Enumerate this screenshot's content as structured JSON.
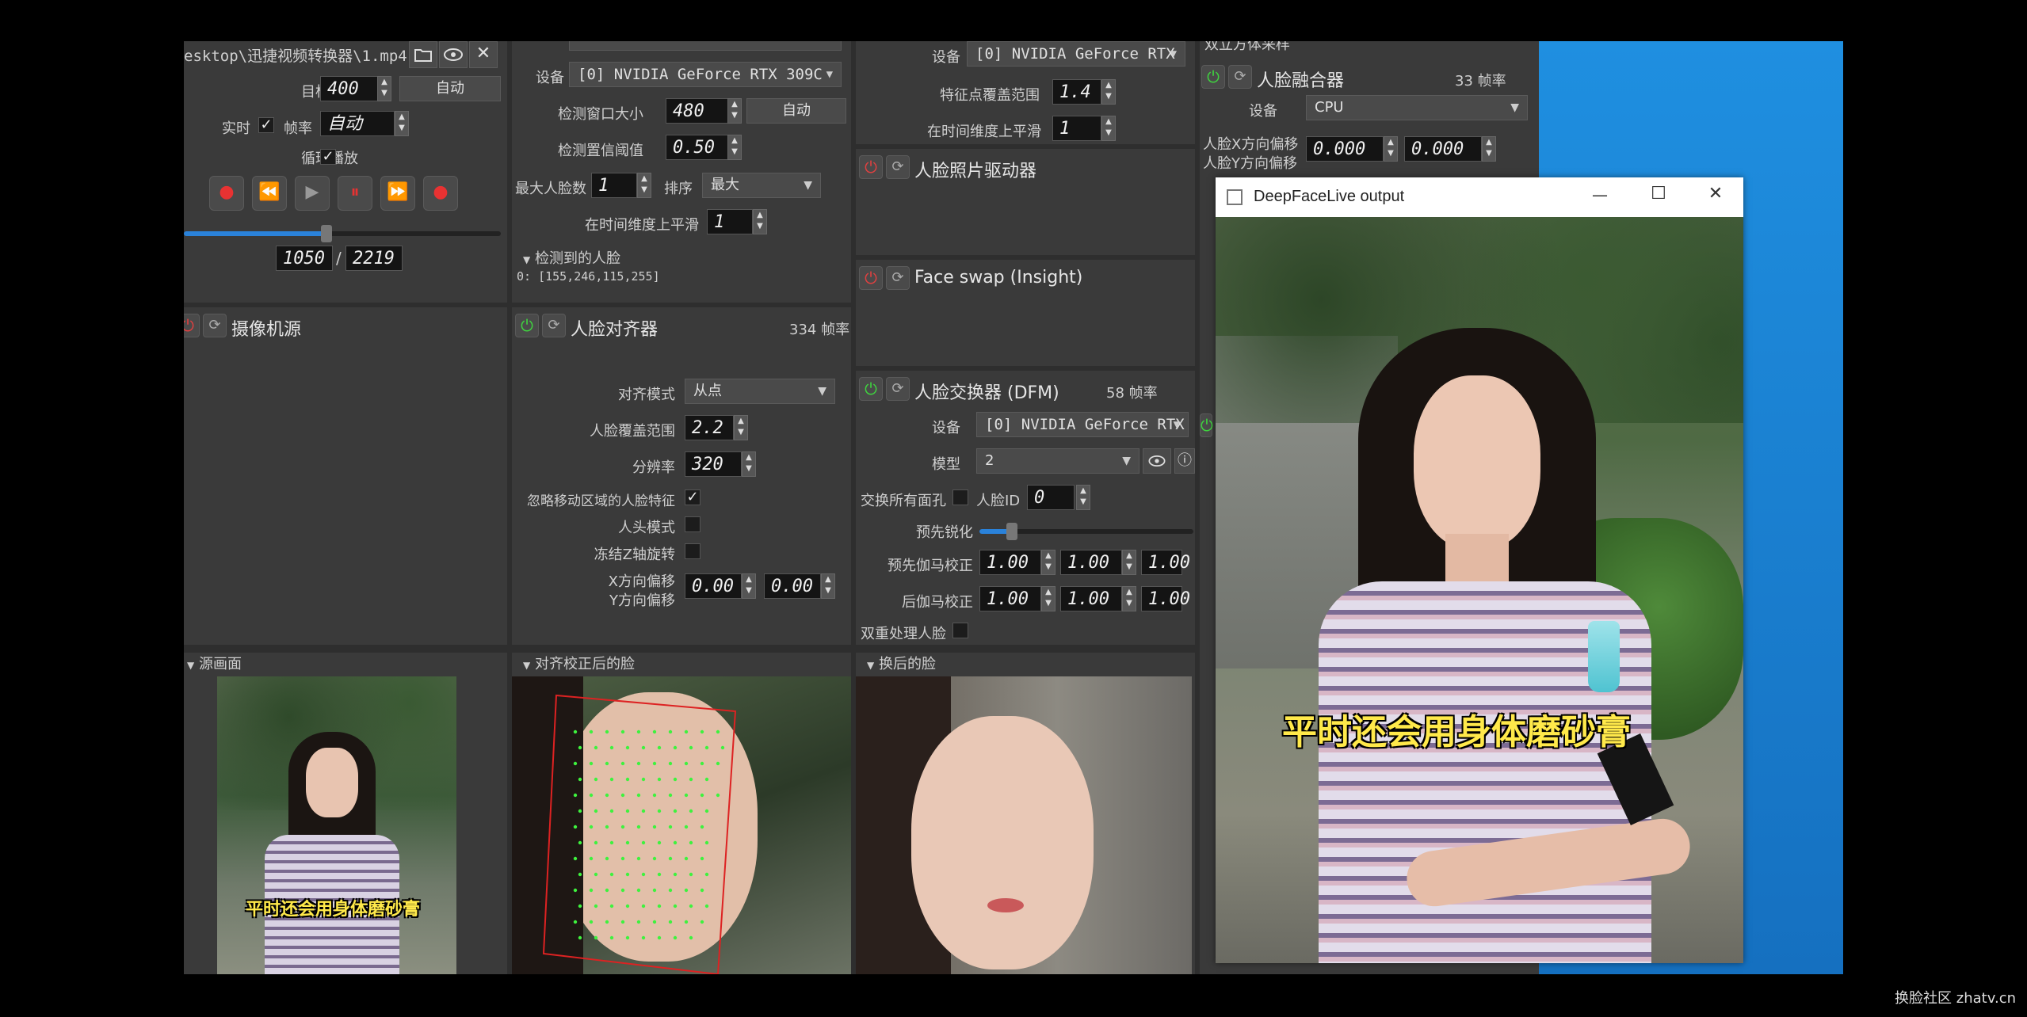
{
  "watermark": "换脸社区 zhatv.cn",
  "source_panel": {
    "path": "esktop\\迅捷视频转换器\\1.mp4",
    "target_width_label": "目标宽度",
    "target_width_value": "400",
    "auto_button": "自动",
    "realtime_label": "实时",
    "fps_label": "帧率",
    "fps_value": "自动",
    "loop_label": "循环播放",
    "frame_current": "1050",
    "frame_separator": "/",
    "frame_total": "2219",
    "progress": 0.45
  },
  "camera_source": {
    "title": "摄像机源"
  },
  "detector": {
    "device_label": "设备",
    "device_value": "[0] NVIDIA GeForce RTX 309C",
    "window_size_label": "检测窗口大小",
    "window_size_value": "480",
    "auto_button": "自动",
    "threshold_label": "检测置信阈值",
    "threshold_value": "0.50",
    "max_faces_label": "最大人脸数",
    "max_faces_value": "1",
    "sort_label": "排序",
    "sort_value": "最大",
    "smooth_label": "在时间维度上平滑",
    "smooth_value": "1",
    "detected_label": "检测到的人脸",
    "detected_value": "0: [155,246,115,255]"
  },
  "aligner": {
    "title": "人脸对齐器",
    "fps": "334 帧率",
    "align_mode_label": "对齐模式",
    "align_mode_value": "从点",
    "coverage_label": "人脸覆盖范围",
    "coverage_value": "2.2",
    "resolution_label": "分辨率",
    "resolution_value": "320",
    "exclude_moving_label": "忽略移动区域的人脸特征",
    "head_mode_label": "人头模式",
    "freeze_z_label": "冻结Z轴旋转",
    "x_offset_label": "X方向偏移",
    "y_offset_label": "Y方向偏移",
    "x_offset_value": "0.00",
    "y_offset_value": "0.00"
  },
  "marker": {
    "device_label": "设备",
    "device_value": "[0] NVIDIA GeForce RTX 3",
    "coverage_label": "特征点覆盖范围",
    "coverage_value": "1.4",
    "smooth_label": "在时间维度上平滑",
    "smooth_value": "1"
  },
  "animator": {
    "title": "人脸照片驱动器"
  },
  "insight": {
    "title": "Face swap (Insight)"
  },
  "dfm": {
    "title": "人脸交换器 (DFM)",
    "fps": "58 帧率",
    "device_label": "设备",
    "device_value": "[0] NVIDIA GeForce RTX",
    "model_label": "模型",
    "model_value": "2",
    "swap_all_label": "交换所有面孔",
    "face_id_label": "人脸ID",
    "face_id_value": "0",
    "presharpen_label": "预先锐化",
    "presharpen_level": 0.15,
    "pre_gamma_label": "预先伽马校正",
    "post_gamma_label": "后伽马校正",
    "gamma_values": [
      "1.00",
      "1.00",
      "1.00"
    ],
    "post_gamma_values": [
      "1.00",
      "1.00",
      "1.00"
    ],
    "two_pass_label": "双重处理人脸"
  },
  "merger": {
    "header_cut": "双立方体采样",
    "title": "人脸融合器",
    "fps": "33 帧率",
    "device_label": "设备",
    "device_value": "CPU",
    "x_offset_label": "人脸X方向偏移",
    "y_offset_label": "人脸Y方向偏移",
    "x_offset_value": "0.000",
    "y_offset_value": "0.000"
  },
  "previews": {
    "source_label": "源画面",
    "aligned_label": "对齐校正后的脸",
    "swapped_label": "换后的脸",
    "subtitle": "平时还会用身体磨砂膏"
  },
  "output_window": {
    "title": "DeepFaceLive output",
    "minimize": "—",
    "maximize": "☐",
    "close": "✕",
    "subtitle": "平时还会用身体磨砂膏"
  },
  "colors": {
    "accent": "#2a82da",
    "desktop_blue": "#1e8ad6",
    "subtitle_yellow": "#ffe94a"
  }
}
